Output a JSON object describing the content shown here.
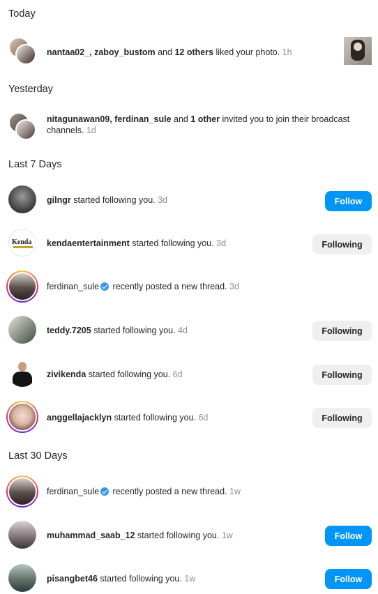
{
  "sections": {
    "today": "Today",
    "yesterday": "Yesterday",
    "last7": "Last 7 Days",
    "last30": "Last 30 Days"
  },
  "notifications": [
    {
      "user1": "nantaa02_",
      "sep": ", ",
      "user2": "zaboy_bustom",
      "and": " and ",
      "others": "12 others",
      "action": " liked your photo. ",
      "time": "1h"
    },
    {
      "user1": "nitagunawan09",
      "sep": ", ",
      "user2": "ferdinan_sule",
      "and": " and ",
      "others": "1 other",
      "action": " invited you to join their broadcast channels. ",
      "time": "1d"
    },
    {
      "user": "gilngr",
      "action": " started following you. ",
      "time": "3d",
      "button": "Follow"
    },
    {
      "user": "kendaentertainment",
      "action": " started following you. ",
      "time": "3d",
      "button": "Following"
    },
    {
      "user": "ferdinan_sule",
      "action": " recently posted a new thread. ",
      "time": "3d"
    },
    {
      "user": "teddy.7205",
      "action": " started following you. ",
      "time": "4d",
      "button": "Following"
    },
    {
      "user": "zivikenda",
      "action": " started following you. ",
      "time": "6d",
      "button": "Following"
    },
    {
      "user": "anggellajacklyn",
      "action": " started following you. ",
      "time": "6d",
      "button": "Following"
    },
    {
      "user": "ferdinan_sule",
      "action": " recently posted a new thread. ",
      "time": "1w"
    },
    {
      "user": "muhammad_saab_12",
      "action": " started following you. ",
      "time": "1w",
      "button": "Follow"
    },
    {
      "user": "pisangbet46",
      "action": " started following you. ",
      "time": "1w",
      "button": "Follow"
    }
  ],
  "colors": {
    "follow_blue": "#0095f6",
    "following_gray": "#efefef",
    "verified_blue": "#3797f0",
    "muted_text": "#8e8e8e"
  }
}
